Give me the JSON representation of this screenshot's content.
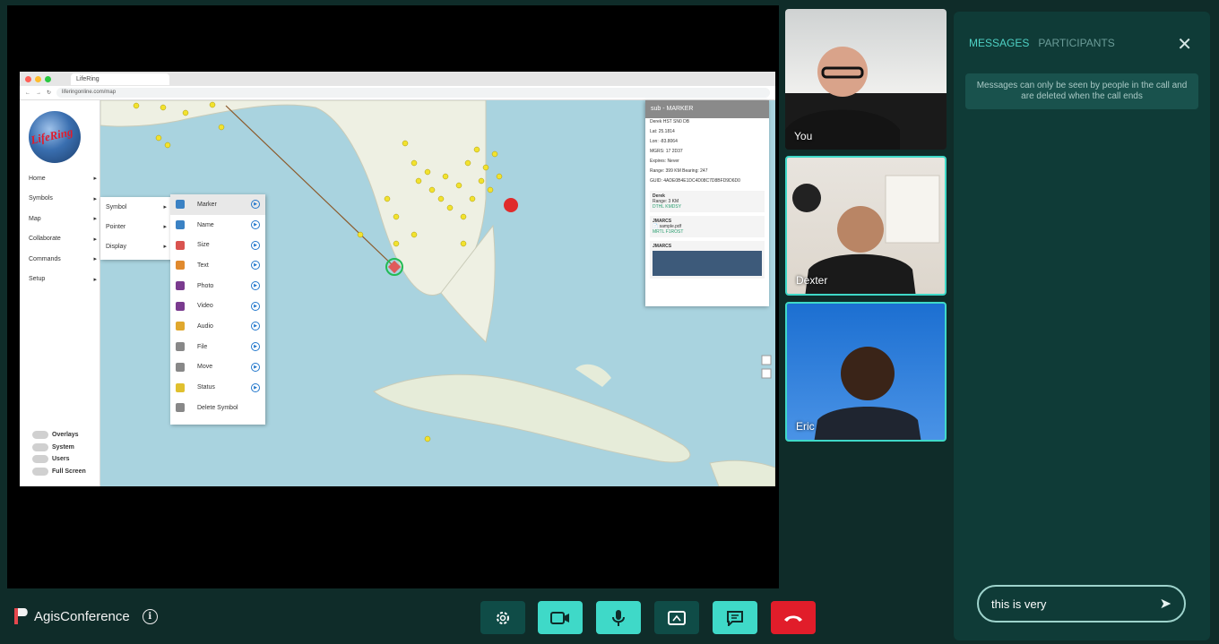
{
  "browser": {
    "tab_title": "LifeRing",
    "url": "liferingonline.com/map"
  },
  "sidebar": {
    "logo_text": "LifeRing",
    "items": [
      {
        "label": "Home"
      },
      {
        "label": "Symbols"
      },
      {
        "label": "Map"
      },
      {
        "label": "Collaborate"
      },
      {
        "label": "Commands"
      },
      {
        "label": "Setup"
      }
    ],
    "toggles": [
      {
        "label": "Overlays"
      },
      {
        "label": "System"
      },
      {
        "label": "Users"
      },
      {
        "label": "Full Screen"
      }
    ]
  },
  "submenu": {
    "items": [
      {
        "label": "Symbol"
      },
      {
        "label": "Pointer"
      },
      {
        "label": "Display"
      }
    ]
  },
  "symbol_menu": {
    "items": [
      {
        "label": "Marker",
        "icon": "marker-icon",
        "color": "#3b82c4"
      },
      {
        "label": "Name",
        "icon": "name-icon",
        "color": "#3b82c4"
      },
      {
        "label": "Size",
        "icon": "size-icon",
        "color": "#d9534f"
      },
      {
        "label": "Text",
        "icon": "text-icon",
        "color": "#e08a2e"
      },
      {
        "label": "Photo",
        "icon": "photo-icon",
        "color": "#7a3b8f"
      },
      {
        "label": "Video",
        "icon": "video-icon",
        "color": "#7a3b8f"
      },
      {
        "label": "Audio",
        "icon": "audio-icon",
        "color": "#e0a82e"
      },
      {
        "label": "File",
        "icon": "file-icon",
        "color": "#888888"
      },
      {
        "label": "Move",
        "icon": "move-icon",
        "color": "#888888"
      },
      {
        "label": "Status",
        "icon": "status-icon",
        "color": "#e0c02e"
      },
      {
        "label": "Delete Symbol",
        "icon": "trash-icon",
        "color": "#888888"
      }
    ]
  },
  "info_panel": {
    "title": "sub - MARKER",
    "rows": [
      "Derek HST SN0 DB",
      "Lat: 25.1814",
      "Lon: -83.8064",
      "MGRS: 17 2D37",
      "Expires: Never",
      "Range: 399 KM   Bearing: 247",
      "GUID: 4ADE0B4E1DC4D08C7D8BFD9D6D0"
    ],
    "cards": [
      {
        "title": "Derek",
        "text": "Range: 3 KM",
        "link": "DTHL KMDSY"
      },
      {
        "title": "JMARCS",
        "text": "sample.pdf",
        "link": "MRTL F1ROST"
      },
      {
        "title": "JMARCS",
        "text": ""
      }
    ]
  },
  "participants": [
    {
      "name": "You"
    },
    {
      "name": "Dexter"
    },
    {
      "name": "Eric"
    }
  ],
  "messages_panel": {
    "tabs": [
      {
        "label": "MESSAGES",
        "active": true
      },
      {
        "label": "PARTICIPANTS",
        "active": false
      }
    ],
    "close_icon": "close-icon",
    "notice": "Messages can only be seen by people in the call and are deleted when the call ends",
    "input_value": "this is very",
    "send_icon": "send-icon"
  },
  "footer": {
    "brand": "AgisConference",
    "info_icon": "info-icon"
  },
  "controls": [
    {
      "name": "settings-button",
      "icon": "gear-icon",
      "color": "#0f4c47"
    },
    {
      "name": "camera-button",
      "icon": "camera-icon",
      "color": "#3fd9c8"
    },
    {
      "name": "microphone-button",
      "icon": "microphone-icon",
      "color": "#3fd9c8"
    },
    {
      "name": "screen-share-button",
      "icon": "screen-share-icon",
      "color": "#0f4c47"
    },
    {
      "name": "chat-button",
      "icon": "chat-icon",
      "color": "#3fd9c8"
    },
    {
      "name": "end-call-button",
      "icon": "hang-up-icon",
      "color": "#e11d2a"
    }
  ],
  "colors": {
    "accent": "#3fd9c8",
    "panel_bg": "#0f3b37",
    "end_call": "#e11d2a"
  }
}
